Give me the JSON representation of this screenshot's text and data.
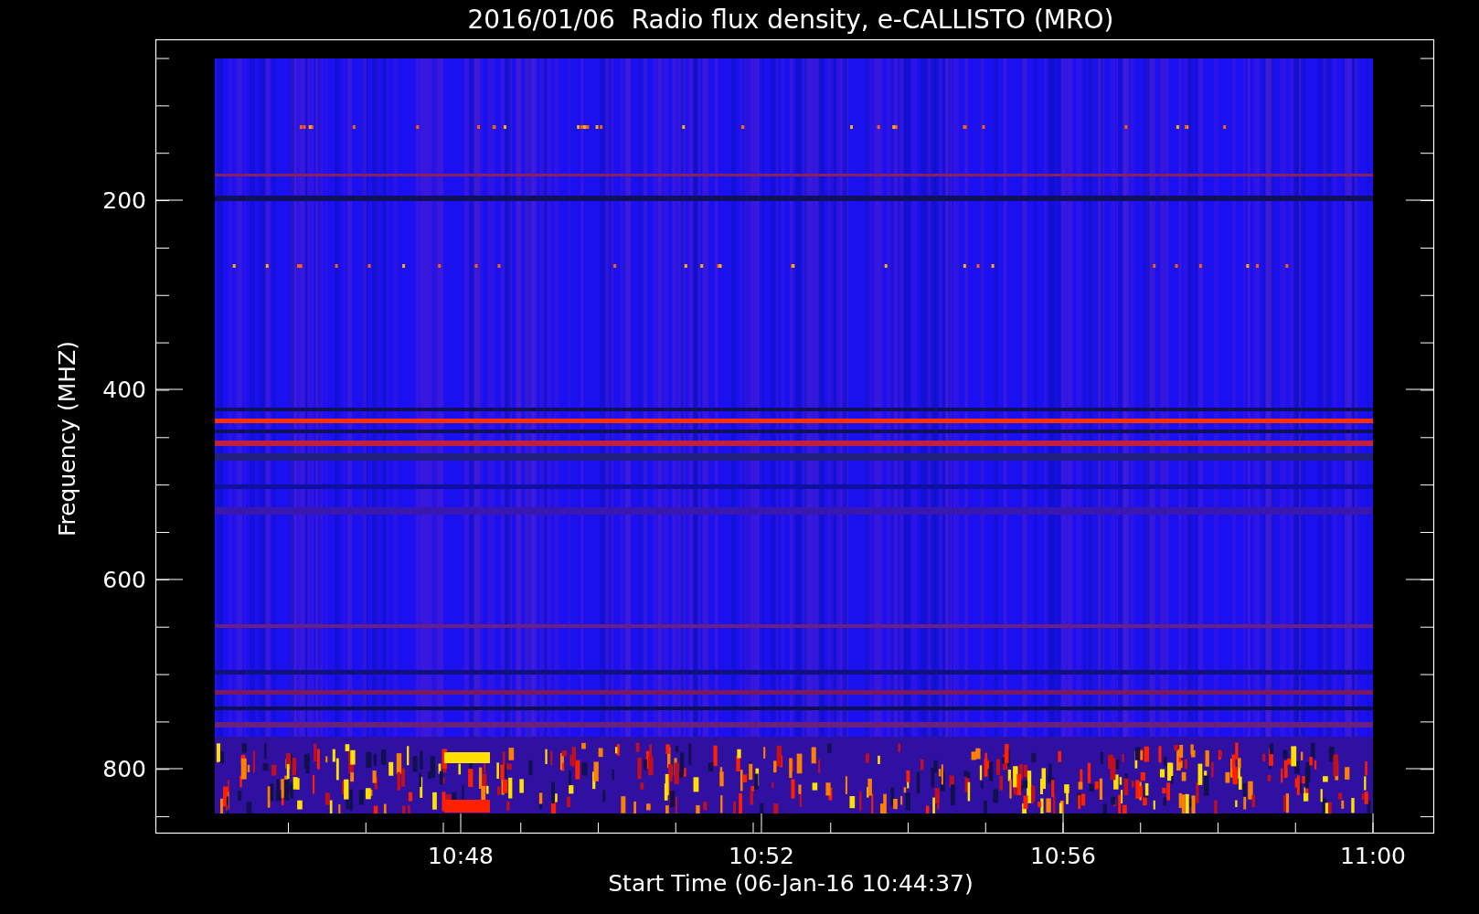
{
  "title": "2016/01/06  Radio flux density, e-CALLISTO (MRO)",
  "y_axis": {
    "label": "Frequency (MHZ)",
    "ticks": [
      "200",
      "400",
      "600",
      "800"
    ]
  },
  "x_axis": {
    "label": "Start Time (06-Jan-16 10:44:37)",
    "ticks": [
      "10:48",
      "10:52",
      "10:56",
      "11:00"
    ]
  }
}
